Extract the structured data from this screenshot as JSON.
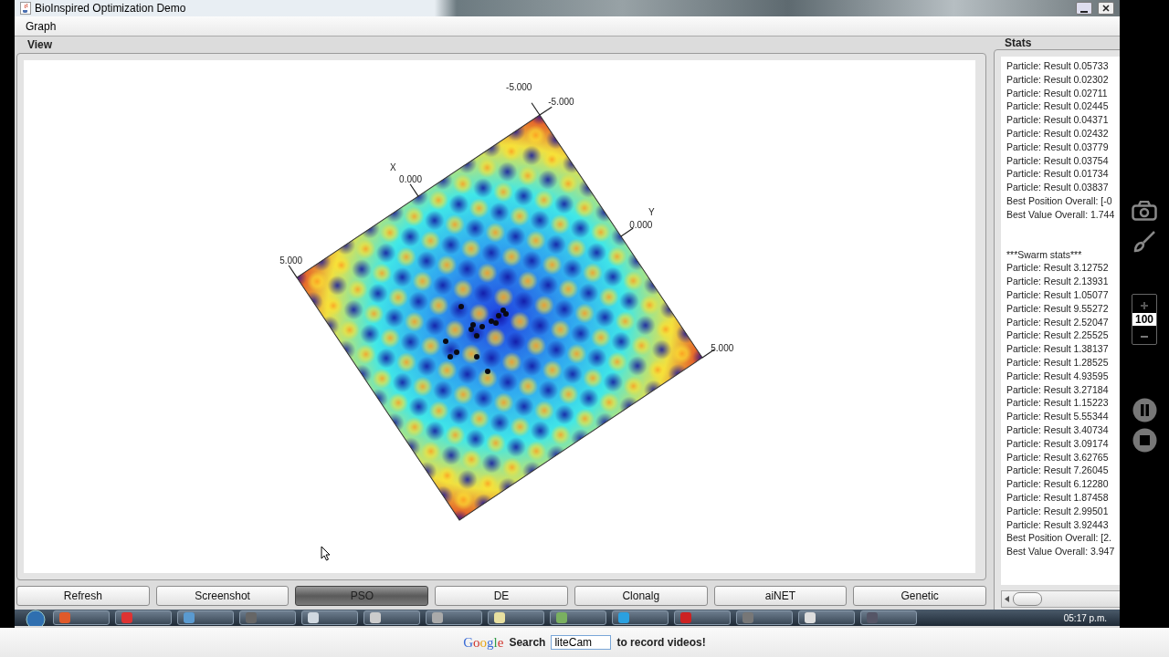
{
  "window": {
    "title": "BioInspired Optimization Demo"
  },
  "menu": [
    {
      "label": "Graph"
    }
  ],
  "view": {
    "title": "View",
    "plot": {
      "x_axis": {
        "title": "X",
        "ticks": [
          "-5.000",
          "0.000",
          "5.000"
        ]
      },
      "y_axis": {
        "title": "Y",
        "ticks": [
          "-5.000",
          "0.000",
          "5.000"
        ]
      }
    }
  },
  "stats": {
    "title": "Stats",
    "blocks": [
      {
        "lines": [
          "Particle: Result 0.05733",
          "Particle: Result 0.02302",
          "Particle: Result 0.02711",
          "Particle: Result 0.02445",
          "Particle: Result 0.04371",
          "Particle: Result 0.02432",
          "Particle: Result 0.03779",
          "Particle: Result 0.03754",
          "Particle: Result 0.01734",
          "Particle: Result 0.03837",
          "Best Position Overall: [-0",
          "Best Value Overall: 1.744"
        ]
      },
      {
        "lines": [
          "***Swarm stats***",
          "Particle: Result 3.12752",
          "Particle: Result 2.13931",
          "Particle: Result 1.05077",
          "Particle: Result 9.55272",
          "Particle: Result 2.52047",
          "Particle: Result 2.25525",
          "Particle: Result 1.38137",
          "Particle: Result 1.28525",
          "Particle: Result 4.93595",
          "Particle: Result 3.27184",
          "Particle: Result 1.15223",
          "Particle: Result 5.55344",
          "Particle: Result 3.40734",
          "Particle: Result 3.09174",
          "Particle: Result 3.62765",
          "Particle: Result 7.26045",
          "Particle: Result 6.12280",
          "Particle: Result 1.87458",
          "Particle: Result 2.99501",
          "Particle: Result 3.92443",
          "Best Position Overall: [2.",
          "Best Value Overall: 3.947"
        ]
      }
    ]
  },
  "buttons": [
    {
      "label": "Refresh",
      "selected": false
    },
    {
      "label": "Screenshot",
      "selected": false
    },
    {
      "label": "PSO",
      "selected": true
    },
    {
      "label": "DE",
      "selected": false
    },
    {
      "label": "Clonalg",
      "selected": false
    },
    {
      "label": "aiNET",
      "selected": false
    },
    {
      "label": "Genetic",
      "selected": false
    }
  ],
  "taskbar": {
    "clock": "05:17 p.m."
  },
  "recorder": {
    "zoom": "100"
  },
  "promo": {
    "logo": "Google",
    "search_label": "Search",
    "value": "liteCam",
    "tail": "to record videos!"
  }
}
